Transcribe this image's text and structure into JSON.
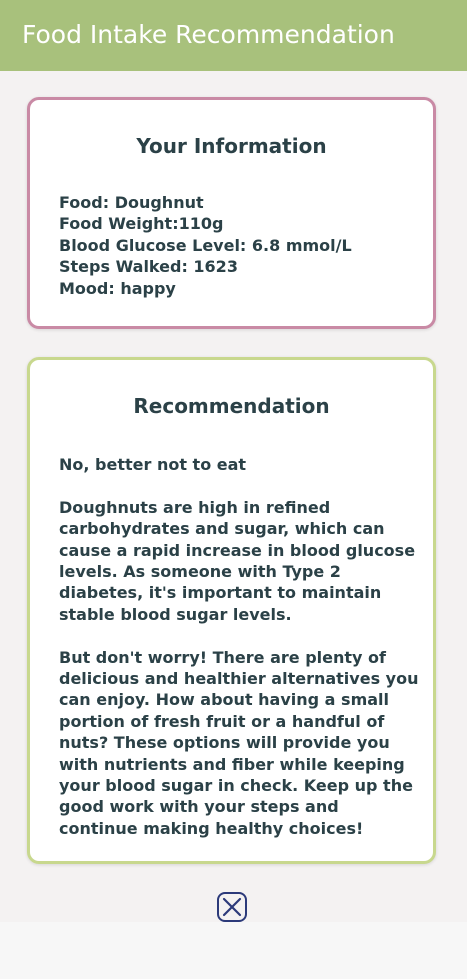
{
  "header": {
    "title": "Food Intake Recommendation"
  },
  "info_card": {
    "title": "Your Information",
    "lines": [
      "Food: Doughnut",
      "Food Weight:110g",
      "Blood Glucose Level: 6.8 mmol/L",
      "Steps Walked: 1623",
      "Mood: happy"
    ]
  },
  "recommendation_card": {
    "title": "Recommendation",
    "paragraphs": [
      "No, better not to eat",
      "Doughnuts are high in refined carbohydrates and sugar, which can cause a rapid increase in blood glucose levels. As someone with Type 2 diabetes, it's important to maintain stable blood sugar levels.",
      "But don't worry! There are plenty of delicious and healthier alternatives you can enjoy. How about having a small portion of fresh fruit or a handful of nuts? These options will provide you with nutrients and fiber while keeping your blood sugar in check. Keep up the good work with your steps and continue making healthy choices!"
    ]
  },
  "close_button": {
    "icon": "close-icon"
  },
  "colors": {
    "app_bar": "#a8c17c",
    "info_border": "#c98aa5",
    "recommendation_border": "#c8d88e",
    "text": "#2b4147",
    "close_icon": "#2c3a7a"
  }
}
